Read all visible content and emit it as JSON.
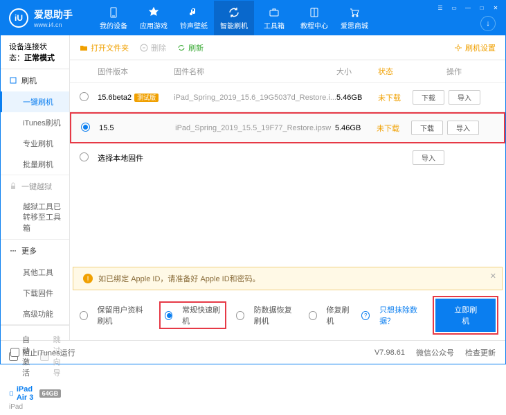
{
  "brand": {
    "name": "爱思助手",
    "url": "www.i4.cn",
    "logo": "iU"
  },
  "nav": [
    {
      "label": "我的设备"
    },
    {
      "label": "应用游戏"
    },
    {
      "label": "铃声壁纸"
    },
    {
      "label": "智能刷机"
    },
    {
      "label": "工具箱"
    },
    {
      "label": "教程中心"
    },
    {
      "label": "爱思商城"
    }
  ],
  "conn": {
    "label": "设备连接状态：",
    "value": "正常模式"
  },
  "sidebar": {
    "flash": {
      "label": "刷机",
      "items": [
        "一键刷机",
        "iTunes刷机",
        "专业刷机",
        "批量刷机"
      ]
    },
    "jailbreak": {
      "label": "一键越狱",
      "note": "越狱工具已转移至工具箱"
    },
    "more": {
      "label": "更多",
      "items": [
        "其他工具",
        "下载固件",
        "高级功能"
      ]
    }
  },
  "device": {
    "autoActivate": "自动激活",
    "skipGuide": "跳过向导",
    "name": "iPad Air 3",
    "storage": "64GB",
    "type": "iPad"
  },
  "toolbar": {
    "open": "打开文件夹",
    "delete": "删除",
    "refresh": "刷新",
    "settings": "刷机设置"
  },
  "table": {
    "headers": {
      "ver": "固件版本",
      "name": "固件名称",
      "size": "大小",
      "status": "状态",
      "ops": "操作"
    }
  },
  "firmware": [
    {
      "ver": "15.6beta2",
      "tag": "测试版",
      "name": "iPad_Spring_2019_15.6_19G5037d_Restore.i...",
      "size": "5.46GB",
      "status": "未下载"
    },
    {
      "ver": "15.5",
      "name": "iPad_Spring_2019_15.5_19F77_Restore.ipsw",
      "size": "5.46GB",
      "status": "未下载"
    }
  ],
  "localFw": "选择本地固件",
  "btns": {
    "download": "下载",
    "import": "导入"
  },
  "warning": "如已绑定 Apple ID，请准备好 Apple ID和密码。",
  "modes": {
    "keep": "保留用户资料刷机",
    "normal": "常规快速刷机",
    "recovery": "防数据恢复刷机",
    "repair": "修复刷机"
  },
  "excludeLink": "只想抹除数据？",
  "flashBtn": "立即刷机",
  "footer": {
    "blockItunes": "阻止iTunes运行",
    "version": "V7.98.61",
    "wechat": "微信公众号",
    "update": "检查更新"
  }
}
